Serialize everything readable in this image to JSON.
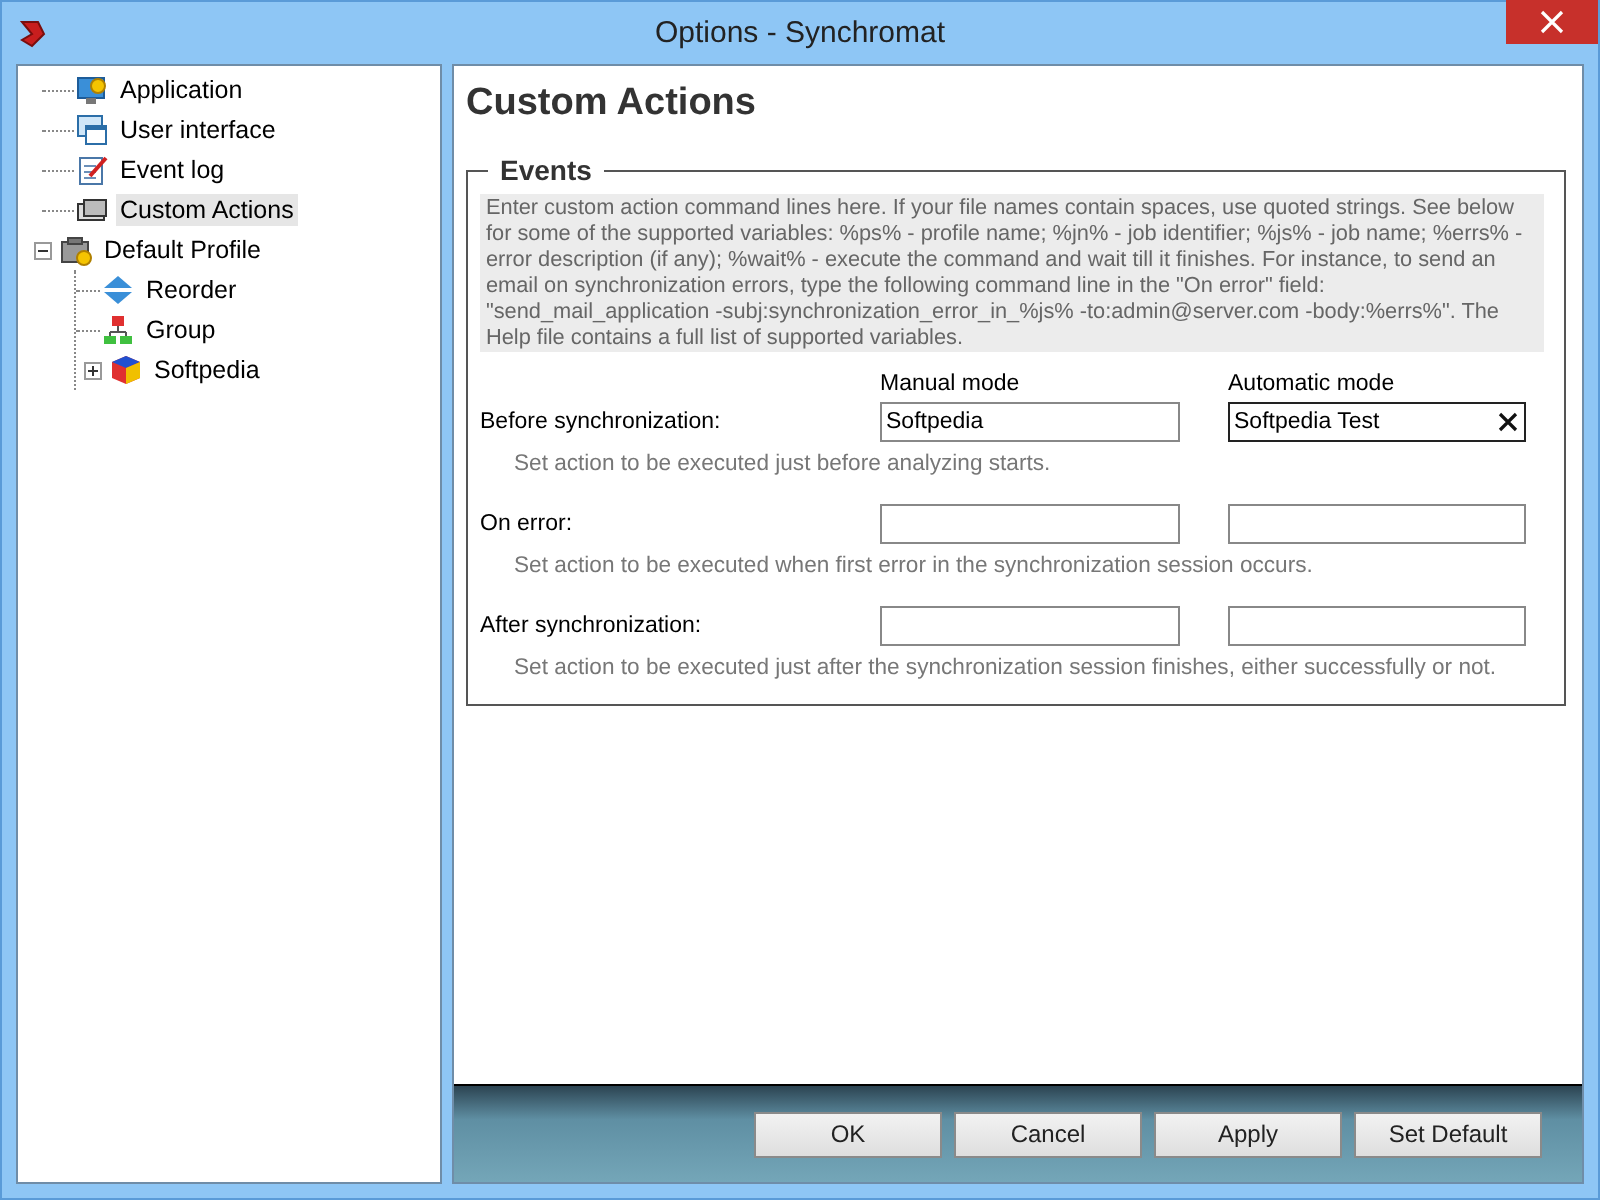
{
  "window": {
    "title": "Options - Synchromat"
  },
  "tree": [
    {
      "label": "Application",
      "selected": false
    },
    {
      "label": "User interface",
      "selected": false
    },
    {
      "label": "Event log",
      "selected": false
    },
    {
      "label": "Custom Actions",
      "selected": true
    },
    {
      "label": "Default Profile",
      "selected": false,
      "expanded": true,
      "children": [
        {
          "label": "Reorder",
          "selected": false
        },
        {
          "label": "Group",
          "selected": false
        },
        {
          "label": "Softpedia",
          "selected": false,
          "expanded": false
        }
      ]
    }
  ],
  "page": {
    "title": "Custom Actions",
    "group_title": "Events",
    "description": "Enter custom action command lines here. If your file names contain spaces, use quoted strings. See below for some of the supported variables: %ps% - profile name; %jn% - job identifier; %js% - job name; %errs% - error description (if any); %wait% - execute the command and wait till it finishes. For instance, to send an email on synchronization errors, type the following command line in the \"On error\" field: \"send_mail_application -subj:synchronization_error_in_%js% -to:admin@server.com -body:%errs%\". The Help file contains a full list of supported variables.",
    "columns": [
      "Manual mode",
      "Automatic mode"
    ],
    "events": [
      {
        "label": "Before synchronization:",
        "manual": {
          "value": "Softpedia"
        },
        "automatic": {
          "value": "Softpedia Test",
          "focused": true
        },
        "hint": "Set action to be executed just before analyzing starts."
      },
      {
        "label": "On error:",
        "hint": "Set action to be executed when first error in the synchronization session occurs."
      },
      {
        "label": "After synchronization:",
        "hint": "Set action to be executed just after the synchronization session finishes, either successfully or not."
      }
    ]
  },
  "buttons": [
    "OK",
    "Cancel",
    "Apply",
    "Set Default"
  ]
}
